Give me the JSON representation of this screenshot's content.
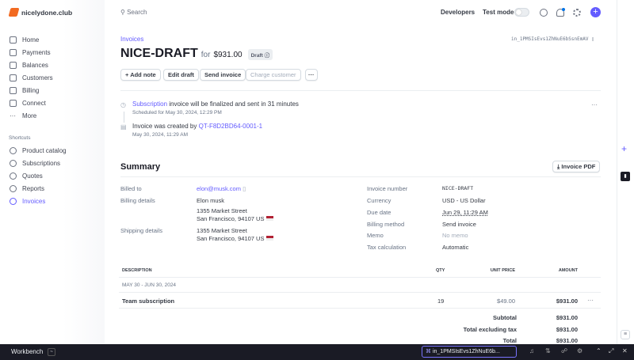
{
  "brand": {
    "name": "nicelydone.club"
  },
  "search": {
    "placeholder": "Search"
  },
  "topbar": {
    "developers": "Developers",
    "test_mode": "Test mode",
    "test_mode_on": false
  },
  "sidebar": {
    "items": [
      {
        "label": "Home"
      },
      {
        "label": "Payments"
      },
      {
        "label": "Balances"
      },
      {
        "label": "Customers"
      },
      {
        "label": "Billing"
      },
      {
        "label": "Connect"
      },
      {
        "label": "More"
      }
    ],
    "shortcuts_title": "Shortcuts",
    "shortcuts": [
      {
        "label": "Product catalog"
      },
      {
        "label": "Subscriptions"
      },
      {
        "label": "Quotes"
      },
      {
        "label": "Reports"
      },
      {
        "label": "Invoices",
        "active": true
      }
    ]
  },
  "page": {
    "breadcrumb": "Invoices",
    "invoice_id": "in_1PMSIsEvs1ZhNuE6bSsnEmAV",
    "title": "NICE-DRAFT",
    "for": "for",
    "amount": "$931.00",
    "status": "Draft"
  },
  "actions": {
    "add_note": "Add note",
    "edit_draft": "Edit draft",
    "send_invoice": "Send invoice",
    "charge_customer": "Charge customer",
    "more": "···"
  },
  "timeline": [
    {
      "link": "Subscription",
      "text": " invoice will be finalized and sent in 31 minutes",
      "sub": "Scheduled for May 30, 2024, 12:29 PM"
    },
    {
      "text": "Invoice was created by ",
      "link": "QT-F8D2BD64-0001-1",
      "sub": "May 30, 2024, 11:29 AM"
    }
  ],
  "summary": {
    "title": "Summary",
    "pdf_button": "Invoice PDF",
    "billed_to_label": "Billed to",
    "billed_to": "elon@musk.com",
    "billing_details_label": "Billing details",
    "billing_name": "Elon musk",
    "billing_street": "1355 Market Street",
    "billing_city": "San Francisco, 94107 US",
    "shipping_details_label": "Shipping details",
    "shipping_street": "1355 Market Street",
    "shipping_city": "San Francisco, 94107 US",
    "right": [
      {
        "label": "Invoice number",
        "value": "NICE-DRAFT"
      },
      {
        "label": "Currency",
        "value": "USD - US Dollar"
      },
      {
        "label": "Due date",
        "value": "Jun 29, 11:29 AM"
      },
      {
        "label": "Billing method",
        "value": "Send invoice"
      },
      {
        "label": "Memo",
        "value": "No memo"
      },
      {
        "label": "Tax calculation",
        "value": "Automatic"
      }
    ]
  },
  "table": {
    "headers": {
      "description": "DESCRIPTION",
      "qty": "QTY",
      "unit_price": "UNIT PRICE",
      "amount": "AMOUNT"
    },
    "period": "MAY 30 - JUN 30, 2024",
    "rows": [
      {
        "description": "Team subscription",
        "qty": "19",
        "unit_price": "$49.00",
        "amount": "$931.00"
      }
    ],
    "totals": [
      {
        "label": "Subtotal",
        "value": "$931.00"
      },
      {
        "label": "Total excluding tax",
        "value": "$931.00"
      },
      {
        "label": "Total",
        "value": "$931.00"
      }
    ]
  },
  "workbench": {
    "title": "Workbench",
    "search_value": "in_1PMSIsEvs1ZhNuE6b..."
  }
}
